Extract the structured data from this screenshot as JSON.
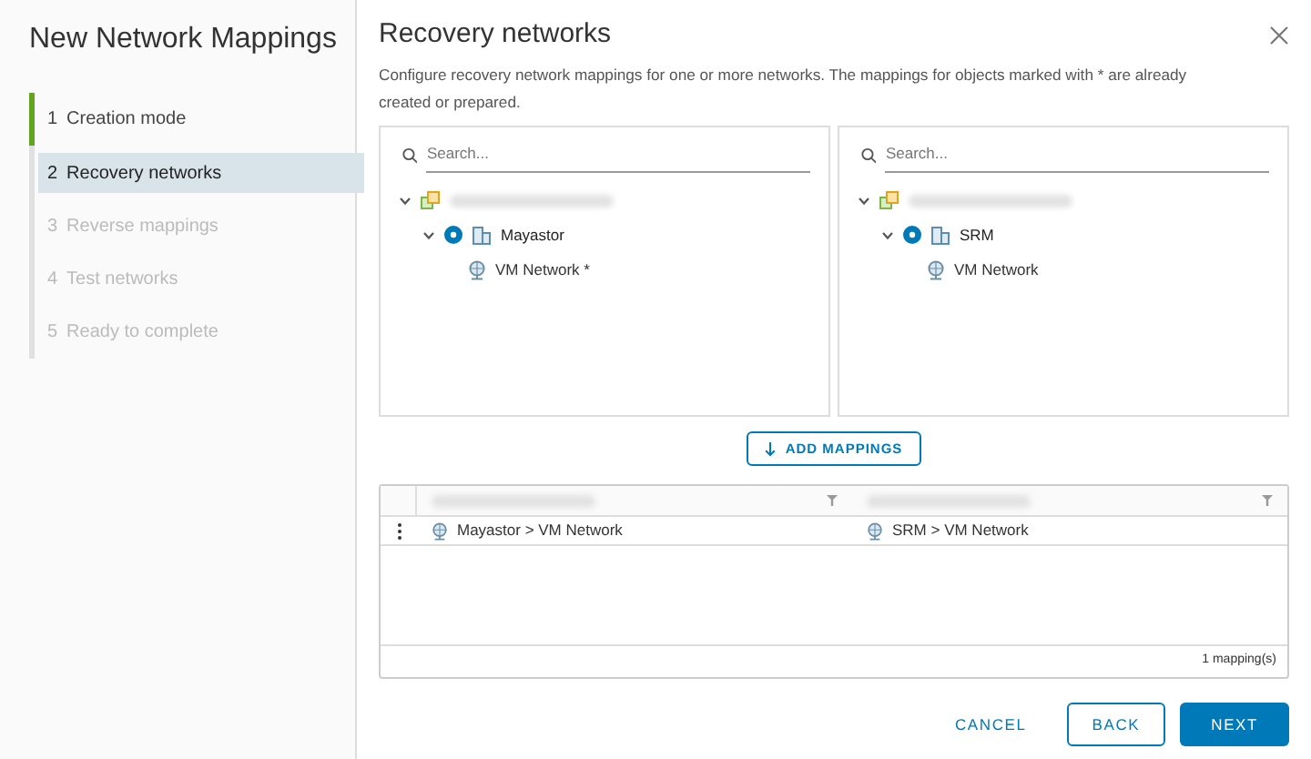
{
  "wizard": {
    "title": "New Network Mappings",
    "steps": [
      {
        "number": "1",
        "label": "Creation mode",
        "selected": false,
        "completed": true,
        "disabled": false
      },
      {
        "number": "2",
        "label": "Recovery networks",
        "selected": true,
        "completed": false,
        "disabled": false
      },
      {
        "number": "3",
        "label": "Reverse mappings",
        "selected": false,
        "completed": false,
        "disabled": true
      },
      {
        "number": "4",
        "label": "Test networks",
        "selected": false,
        "completed": false,
        "disabled": true
      },
      {
        "number": "5",
        "label": "Ready to complete",
        "selected": false,
        "completed": false,
        "disabled": true
      }
    ]
  },
  "page": {
    "title": "Recovery networks",
    "description": "Configure recovery network mappings for one or more networks. The mappings for objects marked with * are already created or prepared."
  },
  "trees": [
    {
      "placeholder": "Search...",
      "nodes": [
        {
          "kind": "vcenter",
          "expanded": true,
          "children": [
            {
              "kind": "datacenter",
              "label": "Mayastor",
              "expanded": true,
              "children": [
                {
                  "kind": "network",
                  "label": "VM Network *"
                }
              ]
            }
          ]
        }
      ]
    },
    {
      "placeholder": "Search...",
      "nodes": [
        {
          "kind": "vcenter",
          "expanded": true,
          "children": [
            {
              "kind": "datacenter",
              "label": "SRM",
              "expanded": true,
              "children": [
                {
                  "kind": "network",
                  "label": "VM Network"
                }
              ]
            }
          ]
        }
      ]
    }
  ],
  "add_button": "ADD MAPPINGS",
  "grid": {
    "rows": [
      {
        "source": "Mayastor > VM Network",
        "target": "SRM > VM Network"
      }
    ],
    "footer": "1 mapping(s)"
  },
  "buttons": [
    {
      "label": "CANCEL",
      "kind": "flat"
    },
    {
      "label": "BACK",
      "kind": "outline"
    },
    {
      "label": "NEXT",
      "kind": "primary"
    }
  ]
}
